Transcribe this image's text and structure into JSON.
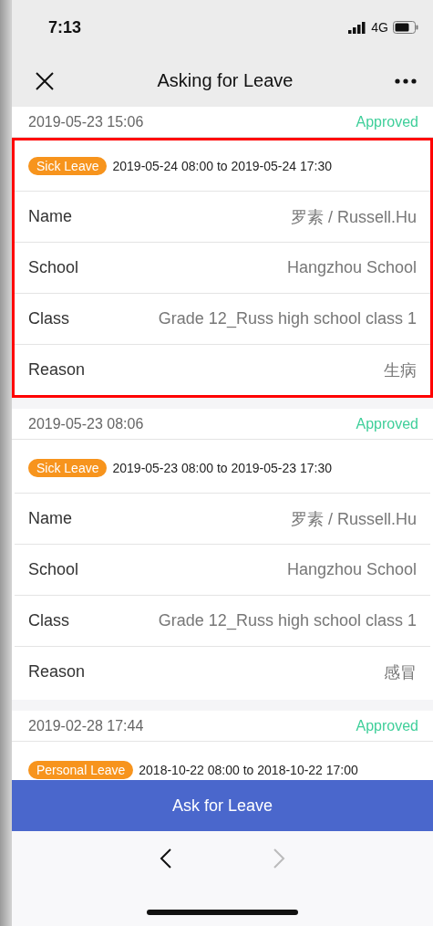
{
  "status_bar": {
    "time": "7:13",
    "network": "4G"
  },
  "nav": {
    "title": "Asking for Leave"
  },
  "records": [
    {
      "submitted": "2019-05-23 15:06",
      "status": "Approved",
      "highlighted": true,
      "leave_type": "Sick Leave",
      "period": "2019-05-24 08:00 to 2019-05-24 17:30",
      "fields": [
        {
          "label": "Name",
          "value": "罗素 / Russell.Hu"
        },
        {
          "label": "School",
          "value": "Hangzhou School"
        },
        {
          "label": "Class",
          "value": "Grade 12_Russ high school class 1"
        },
        {
          "label": "Reason",
          "value": "生病"
        }
      ]
    },
    {
      "submitted": "2019-05-23 08:06",
      "status": "Approved",
      "highlighted": false,
      "leave_type": "Sick Leave",
      "period": "2019-05-23 08:00 to 2019-05-23 17:30",
      "fields": [
        {
          "label": "Name",
          "value": "罗素 / Russell.Hu"
        },
        {
          "label": "School",
          "value": "Hangzhou School"
        },
        {
          "label": "Class",
          "value": "Grade 12_Russ high school class 1"
        },
        {
          "label": "Reason",
          "value": "感冒"
        }
      ]
    },
    {
      "submitted": "2019-02-28 17:44",
      "status": "Approved",
      "highlighted": false,
      "leave_type": "Personal Leave",
      "period": "2018-10-22 08:00 to 2018-10-22 17:00"
    }
  ],
  "primary_button": "Ask for Leave",
  "browser_nav": {
    "back_disabled": false,
    "forward_disabled": true
  }
}
